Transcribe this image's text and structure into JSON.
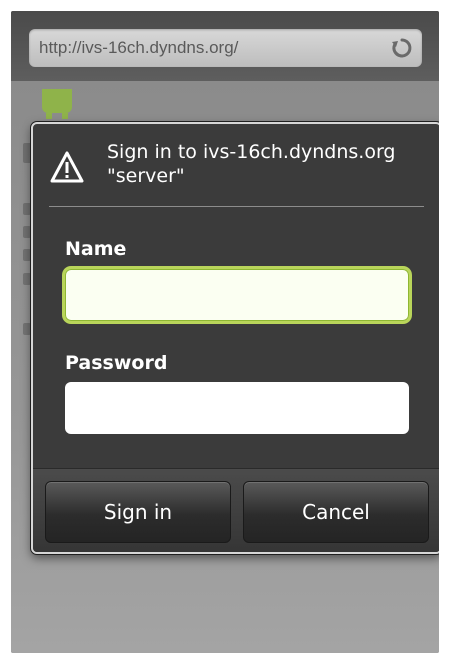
{
  "browser": {
    "url": "http://ivs-16ch.dyndns.org/"
  },
  "dialog": {
    "title": "Sign in to ivs-16ch.dyndns.org \"server\"",
    "name_label": "Name",
    "name_value": "",
    "password_label": "Password",
    "password_value": "",
    "sign_in_label": "Sign in",
    "cancel_label": "Cancel"
  },
  "icons": {
    "refresh": "refresh-icon",
    "alert": "alert-icon",
    "android": "android-logo"
  },
  "colors": {
    "dialog_bg": "#3b3b3b",
    "focus_ring": "#b9d55a",
    "url_text": "#5a5a5a"
  }
}
